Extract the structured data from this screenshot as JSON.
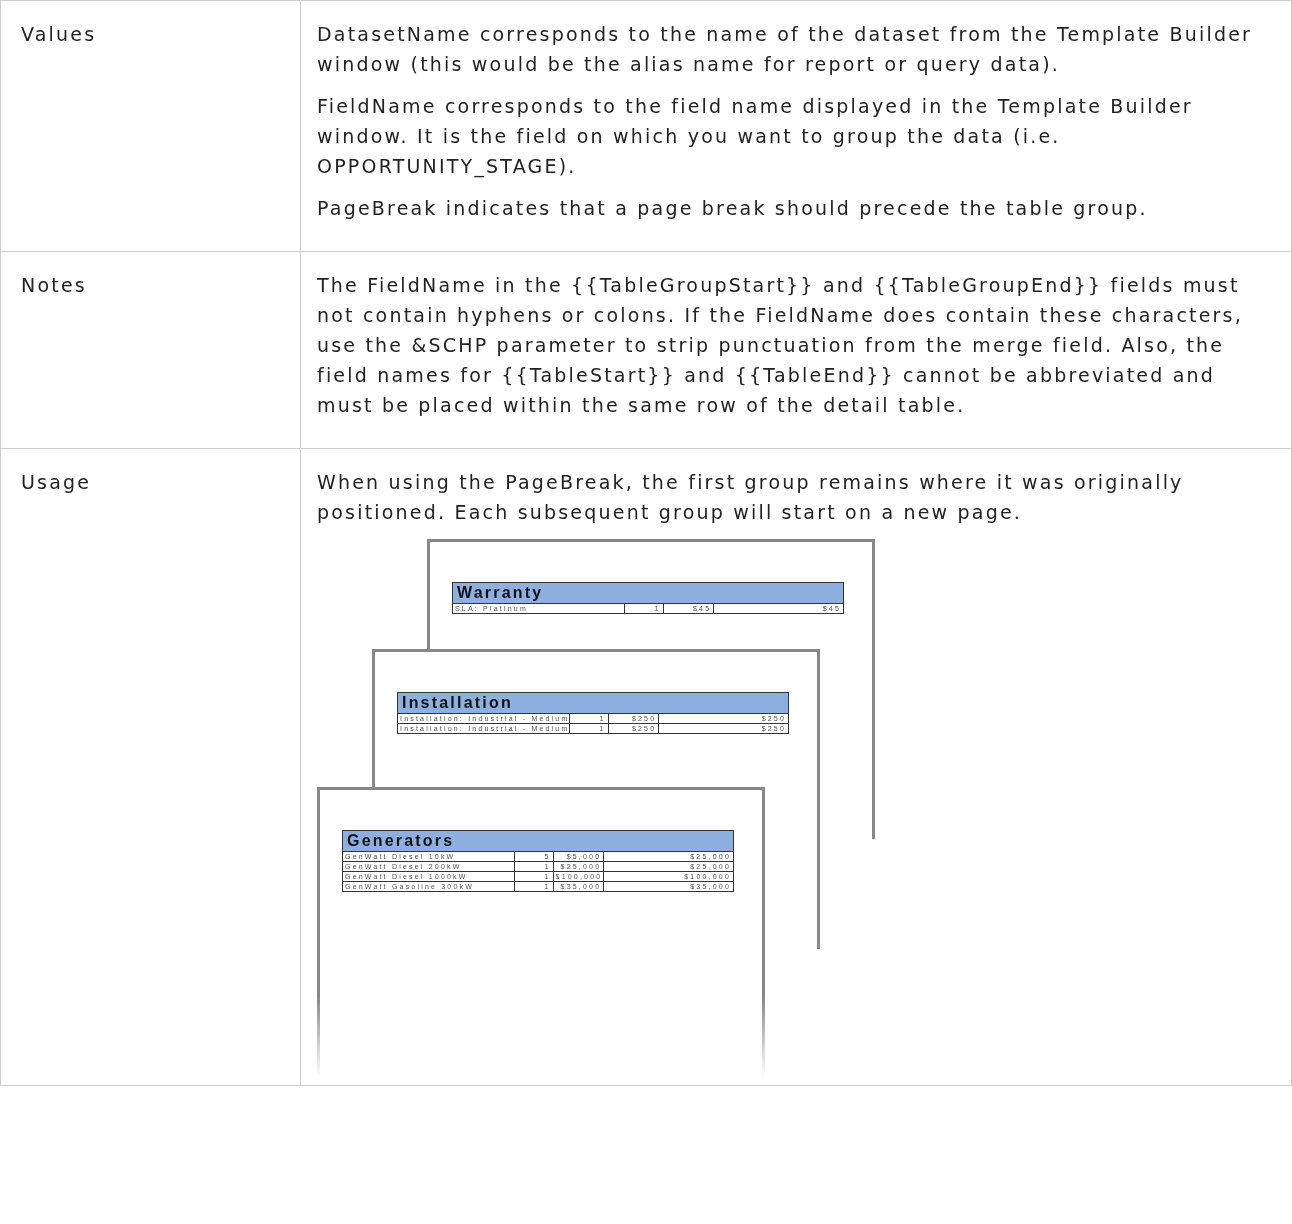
{
  "rows": [
    {
      "label": "Values",
      "paragraphs": [
        "DatasetName corresponds to the name of the dataset from the Template Builder window (this would be the alias name for report or query data).",
        "FieldName corresponds to the field name displayed in the Template Builder window. It is the field on which you want to group the data (i.e. OPPORTUNITY_STAGE).",
        "PageBreak indicates that a page break should precede the table group."
      ]
    },
    {
      "label": "Notes",
      "paragraphs": [
        "The FieldName in the {{TableGroupStart}} and {{TableGroupEnd}} fields must not contain hyphens or colons. If the FieldName does contain these characters, use the &SCHP parameter to strip punctuation from the merge field. Also, the field names for {{TableStart}} and {{TableEnd}} cannot be abbreviated and must be placed within the same row of the detail table."
      ]
    },
    {
      "label": "Usage",
      "paragraphs": [
        "When using the PageBreak, the first group remains where it was originally positioned. Each subsequent group will start on a new page."
      ],
      "illustration": {
        "pages": [
          {
            "title": "Warranty",
            "rows": [
              [
                "SLA: Platinum",
                "1",
                "$45",
                "$45"
              ]
            ]
          },
          {
            "title": "Installation",
            "rows": [
              [
                "Installation: Industrial - Medium",
                "1",
                "$250",
                "$250"
              ],
              [
                "Installation: Industrial - Medium",
                "1",
                "$250",
                "$250"
              ]
            ]
          },
          {
            "title": "Generators",
            "rows": [
              [
                "GenWatt Diesel 10kW",
                "5",
                "$5,000",
                "$25,000"
              ],
              [
                "GenWatt Diesel 200kW",
                "1",
                "$25,000",
                "$25,000"
              ],
              [
                "GenWatt Diesel 1000kW",
                "1",
                "$100,000",
                "$100,000"
              ],
              [
                "GenWatt Gasoline 300kW",
                "1",
                "$35,000",
                "$35,000"
              ]
            ]
          }
        ]
      }
    }
  ]
}
